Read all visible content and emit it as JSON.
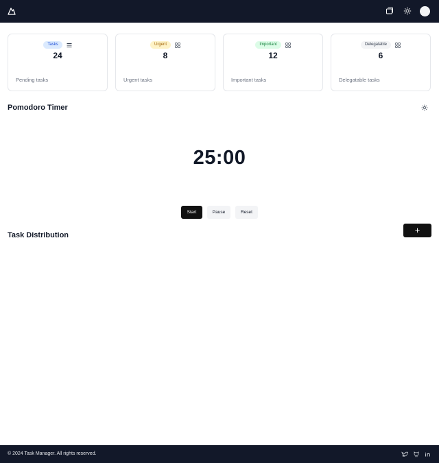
{
  "header": {
    "logo_icon": "mountain-logo-icon",
    "icons": [
      "notes-icon",
      "settings-icon"
    ],
    "avatar": "user-avatar"
  },
  "cards": [
    {
      "badge": "Tasks",
      "badge_color": "#dbeafe",
      "icon": "list-icon",
      "count": "24",
      "caption": "Pending tasks"
    },
    {
      "badge": "Urgent",
      "badge_color": "#fef3c7",
      "icon": "grid-icon",
      "count": "8",
      "caption": "Urgent tasks"
    },
    {
      "badge": "Important",
      "badge_color": "#dcfce7",
      "icon": "grid-icon",
      "count": "12",
      "caption": "Important tasks"
    },
    {
      "badge": "Delegatable",
      "badge_color": "#f3f4f6",
      "icon": "grid-icon",
      "count": "6",
      "caption": "Delegatable tasks"
    }
  ],
  "pomodoro": {
    "title": "Pomodoro Timer",
    "time": "25:00",
    "settings_icon": "settings-icon",
    "buttons": {
      "start": "Start",
      "pause": "Pause",
      "reset": "Reset"
    }
  },
  "distribution": {
    "title": "Task Distribution",
    "add_label": "+"
  },
  "footer": {
    "copyright": "© 2024 Task Manager. All rights reserved.",
    "icons": [
      "twitter-icon",
      "github-icon",
      "linkedin-icon"
    ]
  }
}
